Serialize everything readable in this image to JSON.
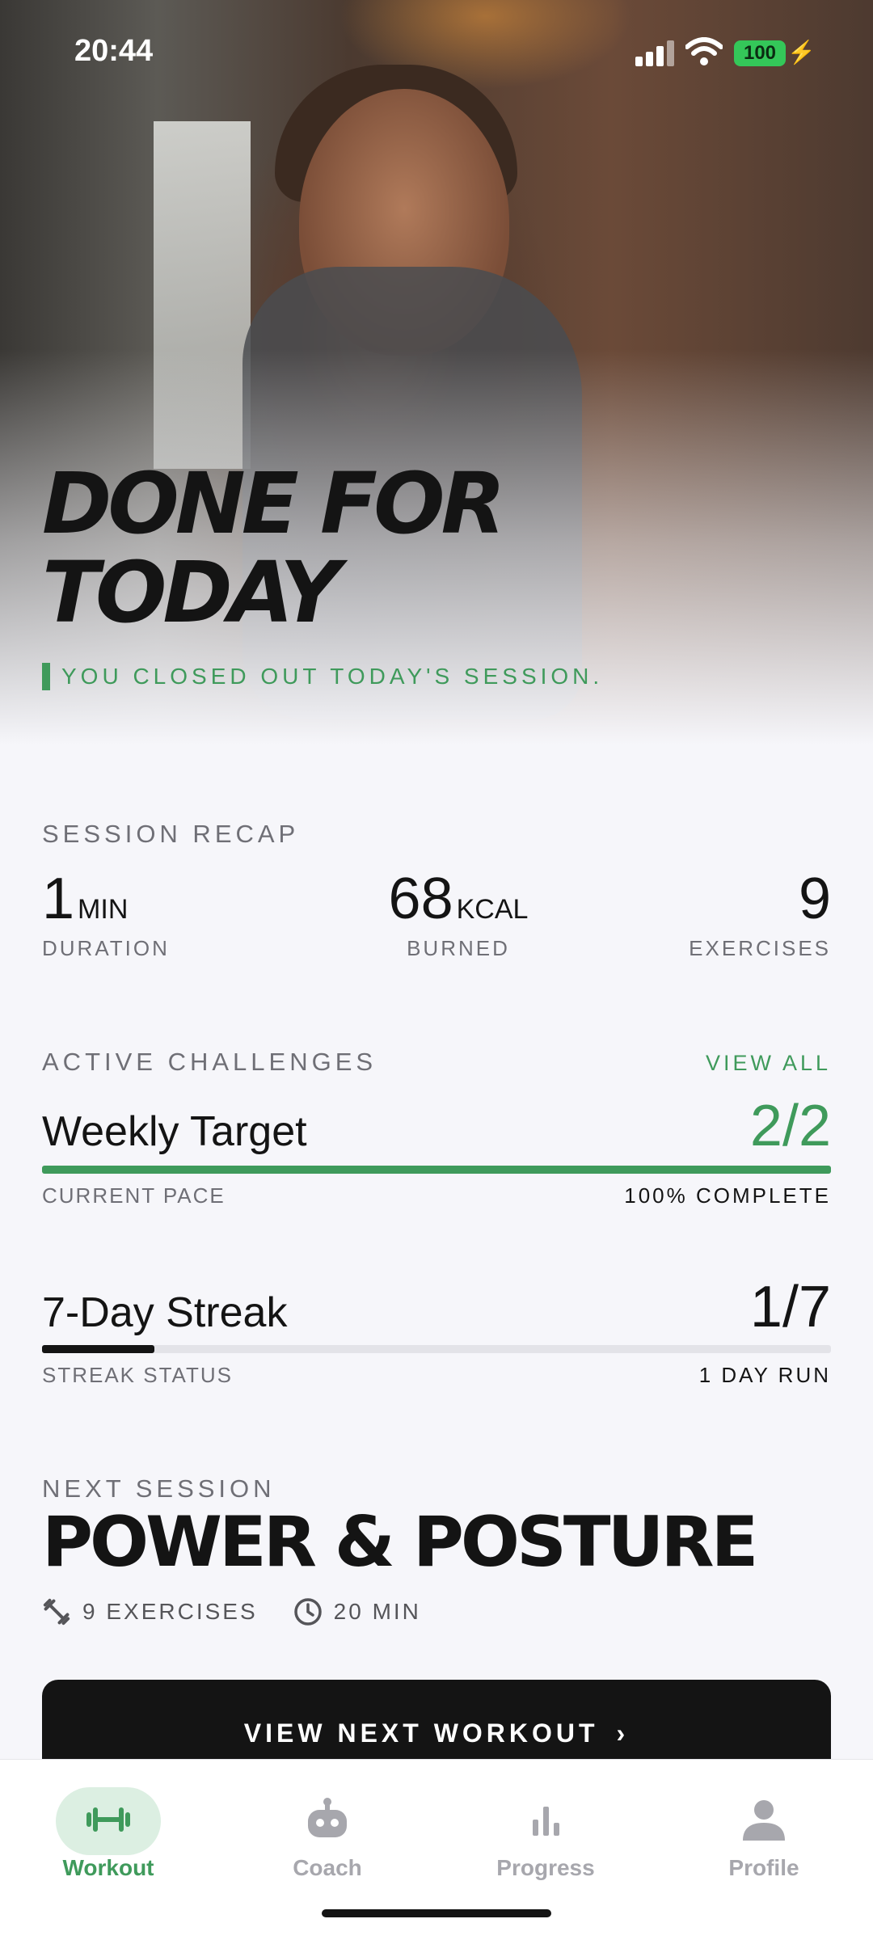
{
  "status_bar": {
    "time": "20:44",
    "battery": "100"
  },
  "hero": {
    "title_line1": "DONE FOR",
    "title_line2": "TODAY",
    "subtitle": "YOU CLOSED OUT TODAY'S SESSION."
  },
  "recap": {
    "label": "SESSION RECAP",
    "duration": {
      "value": "1",
      "unit": "MIN",
      "caption": "DURATION"
    },
    "burned": {
      "value": "68",
      "unit": "KCAL",
      "caption": "BURNED"
    },
    "exercises": {
      "value": "9",
      "caption": "EXERCISES"
    }
  },
  "challenges": {
    "label": "ACTIVE CHALLENGES",
    "view_all": "VIEW ALL",
    "weekly": {
      "name": "Weekly Target",
      "value": "2/2",
      "progress": 1.0,
      "caption_left": "CURRENT PACE",
      "caption_right": "100% COMPLETE"
    },
    "streak": {
      "name": "7-Day Streak",
      "value": "1/7",
      "progress": 0.1429,
      "caption_left": "STREAK STATUS",
      "caption_right": "1 DAY RUN"
    }
  },
  "next_session": {
    "label": "NEXT SESSION",
    "title": "POWER & POSTURE",
    "exercises": "9 EXERCISES",
    "duration": "20 MIN",
    "cta": "VIEW NEXT WORKOUT"
  },
  "tabs": [
    {
      "label": "Workout",
      "icon": "dumbbell-icon",
      "active": true
    },
    {
      "label": "Coach",
      "icon": "robot-icon",
      "active": false
    },
    {
      "label": "Progress",
      "icon": "bar-chart-icon",
      "active": false
    },
    {
      "label": "Profile",
      "icon": "person-icon",
      "active": false
    }
  ],
  "colors": {
    "accent": "#3f9a5b",
    "text": "#141414",
    "muted": "#6f6f76",
    "background": "#f6f6fa"
  }
}
